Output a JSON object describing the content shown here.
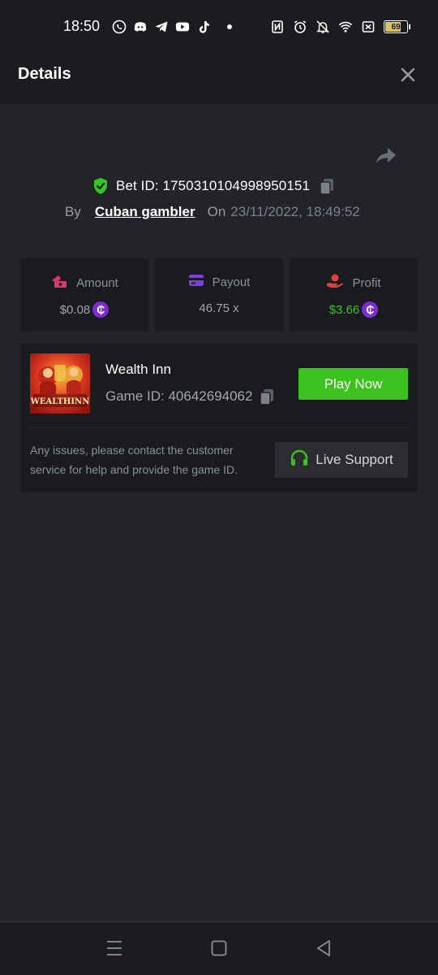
{
  "status_bar": {
    "time": "18:50",
    "left_icons": [
      "whatsapp-icon",
      "discord-icon",
      "telegram-icon",
      "youtube-icon",
      "tiktok-icon",
      "dot-icon"
    ],
    "right_icons": [
      "nfc-icon",
      "alarm-icon",
      "bell-off-icon",
      "wifi-icon",
      "sim-icon",
      "battery-icon"
    ],
    "battery": "69"
  },
  "header": {
    "title": "Details"
  },
  "bet": {
    "id_text": "Bet ID: 1750310104998950151",
    "by_label": "By",
    "user": "Cuban gambler",
    "on_label": "On",
    "datetime": "23/11/2022, 18:49:52"
  },
  "stats": [
    {
      "label": "Amount",
      "value": "$0.08",
      "icon": "amount-icon",
      "coin": true,
      "value_color": "#a3a6ad"
    },
    {
      "label": "Payout",
      "value": "46.75 x",
      "icon": "payout-icon",
      "coin": false,
      "value_color": "#a3a6ad"
    },
    {
      "label": "Profit",
      "value": "$3.66",
      "icon": "profit-icon",
      "coin": true,
      "value_color": "#34c61e"
    }
  ],
  "coin_symbol": "₵",
  "game": {
    "name": "Wealth Inn",
    "id_text": "Game ID: 40642694062",
    "thumb_text": "WEALTHINN",
    "play_label": "Play Now",
    "issues_text": "Any issues, please contact the customer service for help and provide the game ID.",
    "support_label": "Live Support"
  },
  "colors": {
    "background": "#232429",
    "panel": "#1a1b1f",
    "accent_green": "#3cc21f",
    "coin_purple": "#7b2cd6",
    "amount_pink": "#e0366f",
    "payout_purple": "#7b3fe4",
    "profit_red": "#e0423a"
  }
}
